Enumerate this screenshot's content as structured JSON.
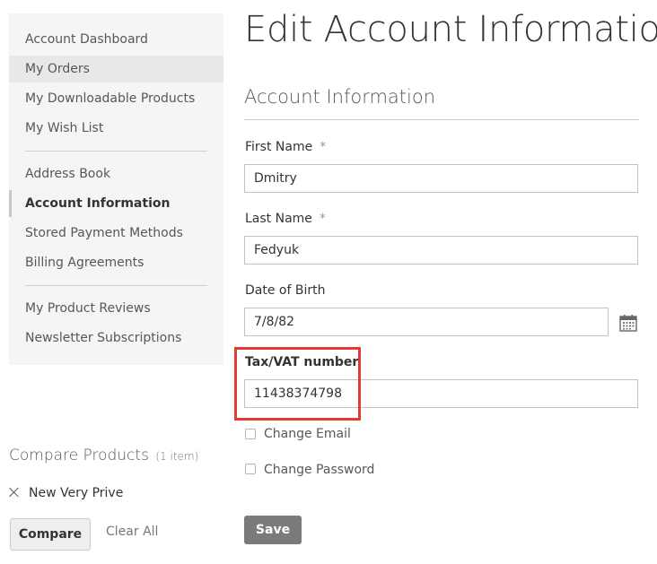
{
  "sidebar": {
    "items": [
      {
        "label": "Account Dashboard"
      },
      {
        "label": "My Orders"
      },
      {
        "label": "My Downloadable Products"
      },
      {
        "label": "My Wish List"
      },
      {
        "label": "Address Book"
      },
      {
        "label": "Account Information"
      },
      {
        "label": "Stored Payment Methods"
      },
      {
        "label": "Billing Agreements"
      },
      {
        "label": "My Product Reviews"
      },
      {
        "label": "Newsletter Subscriptions"
      }
    ]
  },
  "compare": {
    "title": "Compare Products",
    "count": "(1 item)",
    "item": "New Very Prive",
    "compare_label": "Compare",
    "clear_label": "Clear All"
  },
  "main": {
    "page_title": "Edit Account Information",
    "section_title": "Account Information",
    "first_name": {
      "label": "First Name",
      "required": "*",
      "value": "Dmitry"
    },
    "last_name": {
      "label": "Last Name",
      "required": "*",
      "value": "Fedyuk"
    },
    "dob": {
      "label": "Date of Birth",
      "value": "7/8/82"
    },
    "tax": {
      "label": "Tax/VAT number",
      "value": "11438374798"
    },
    "change_email": "Change Email",
    "change_password": "Change Password",
    "save_label": "Save"
  },
  "colors": {
    "highlight": "#e53935",
    "save_button": "#7a7a7a"
  }
}
